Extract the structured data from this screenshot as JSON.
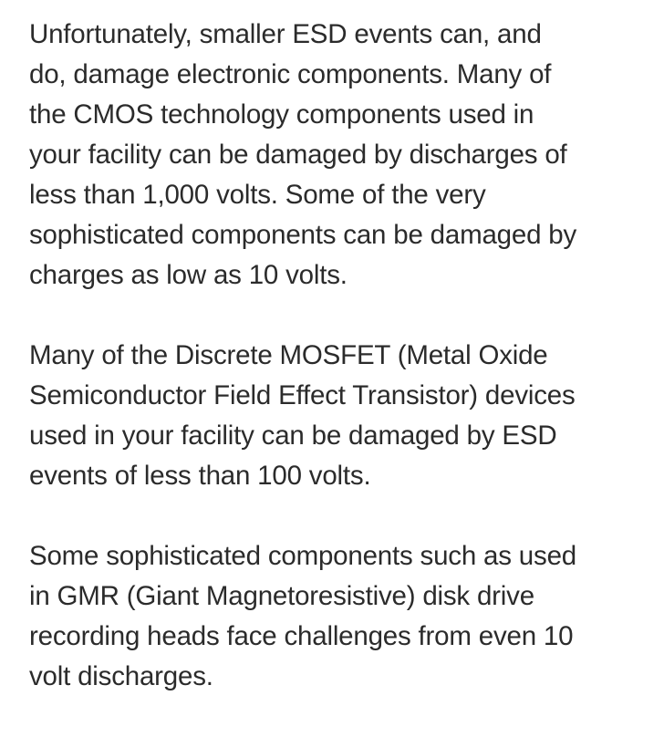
{
  "paragraphs": [
    {
      "lines": [
        "Unfortunately, smaller ESD events can, and",
        "do, damage electronic components. Many of",
        "the CMOS technology components used in",
        "your facility can be damaged by discharges of",
        "less than 1,000 volts. Some of the very",
        "sophisticated components can be damaged by",
        "charges as low as 10 volts."
      ]
    },
    {
      "lines": [
        "Many of the Discrete MOSFET (Metal Oxide",
        "Semiconductor Field Effect Transistor) devices",
        "used in your facility can be damaged by ESD",
        "events of less than 100 volts."
      ]
    },
    {
      "lines": [
        "Some sophisticated components such as used",
        "in GMR (Giant Magnetoresistive) disk drive",
        "recording heads face challenges from even 10",
        "volt discharges."
      ]
    }
  ]
}
